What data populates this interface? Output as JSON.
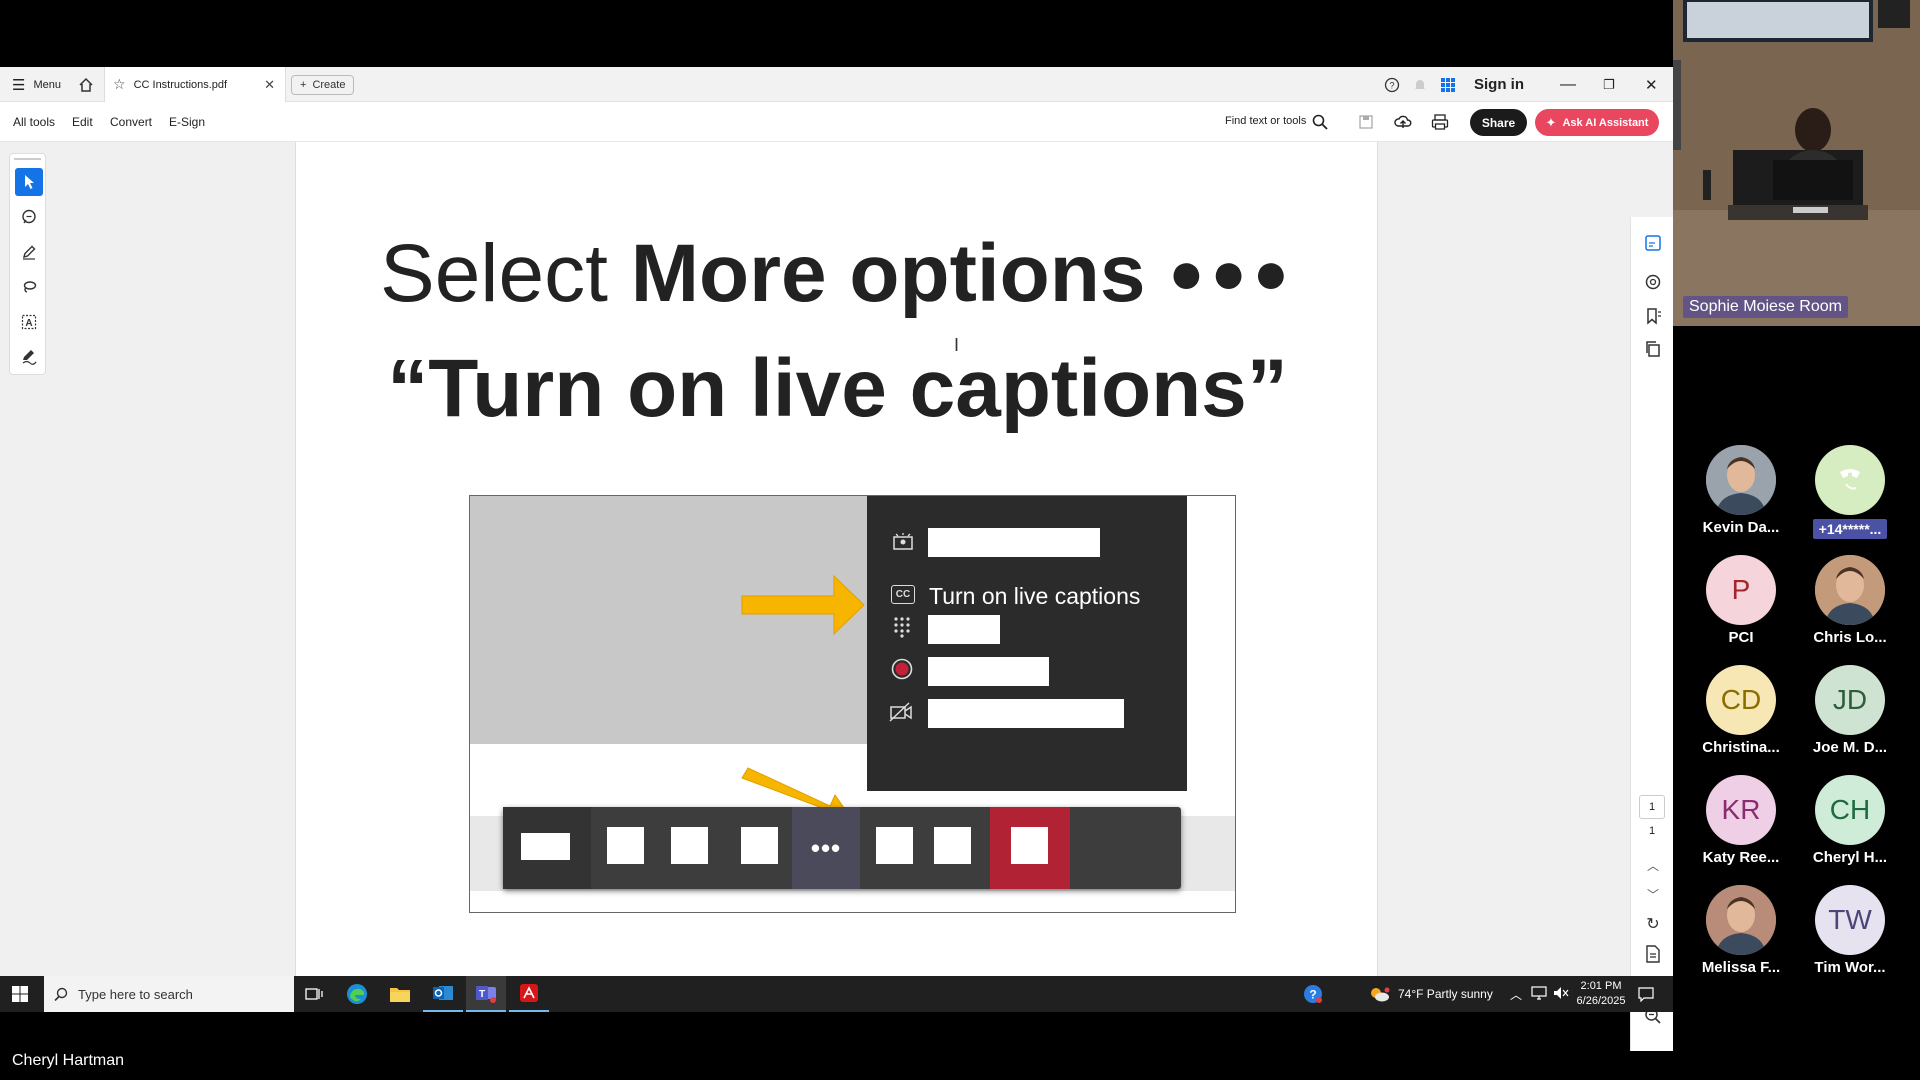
{
  "acrobat": {
    "menu_label": "Menu",
    "tab_title": "CC Instructions.pdf",
    "create_label": "Create",
    "sign_in": "Sign in",
    "toolbar": {
      "all_tools": "All tools",
      "edit": "Edit",
      "convert": "Convert",
      "esign": "E-Sign",
      "find": "Find text or tools",
      "share": "Share",
      "ask_ai": "Ask AI Assistant"
    },
    "page_indicator": {
      "current": "1",
      "total": "1"
    }
  },
  "slide": {
    "title_select": "Select",
    "title_more": "More options",
    "title_dots": "●●●",
    "title_line2": "“Turn on live captions”",
    "menu_caption_label": "Turn on live captions",
    "cc_glyph": "CC",
    "more_dots": "•••"
  },
  "taskbar": {
    "search_placeholder": "Type here to search",
    "weather": "74°F  Partly sunny",
    "time": "2:01 PM",
    "date": "6/26/2025"
  },
  "meeting": {
    "room_label": "Sophie Moiese Room",
    "presenter": "Cheryl Hartman",
    "participants": [
      {
        "name": "Kevin Da...",
        "initials": "",
        "color": "#9aa3ab"
      },
      {
        "name": "+14*****...",
        "initials": "",
        "color": "#d6ecc1"
      },
      {
        "name": "PCI",
        "initials": "P",
        "color": "#f6d4dc"
      },
      {
        "name": "Chris Lo...",
        "initials": "",
        "color": "#c49b7a"
      },
      {
        "name": "Christina...",
        "initials": "CD",
        "color": "#f7e7b5"
      },
      {
        "name": "Joe M. D...",
        "initials": "JD",
        "color": "#cfe3d3"
      },
      {
        "name": "Katy Ree...",
        "initials": "KR",
        "color": "#efcfe6"
      },
      {
        "name": "Cheryl H...",
        "initials": "CH",
        "color": "#cfecd9"
      },
      {
        "name": "Melissa F...",
        "initials": "",
        "color": "#b98c79"
      },
      {
        "name": "Tim Wor...",
        "initials": "TW",
        "color": "#e6e2ef"
      }
    ]
  },
  "colors": {
    "ai_button": "#e8475f",
    "selected_tool": "#1473e6",
    "arrow": "#f7b500",
    "record_dot": "#c4203a",
    "hangup": "#b22235"
  }
}
